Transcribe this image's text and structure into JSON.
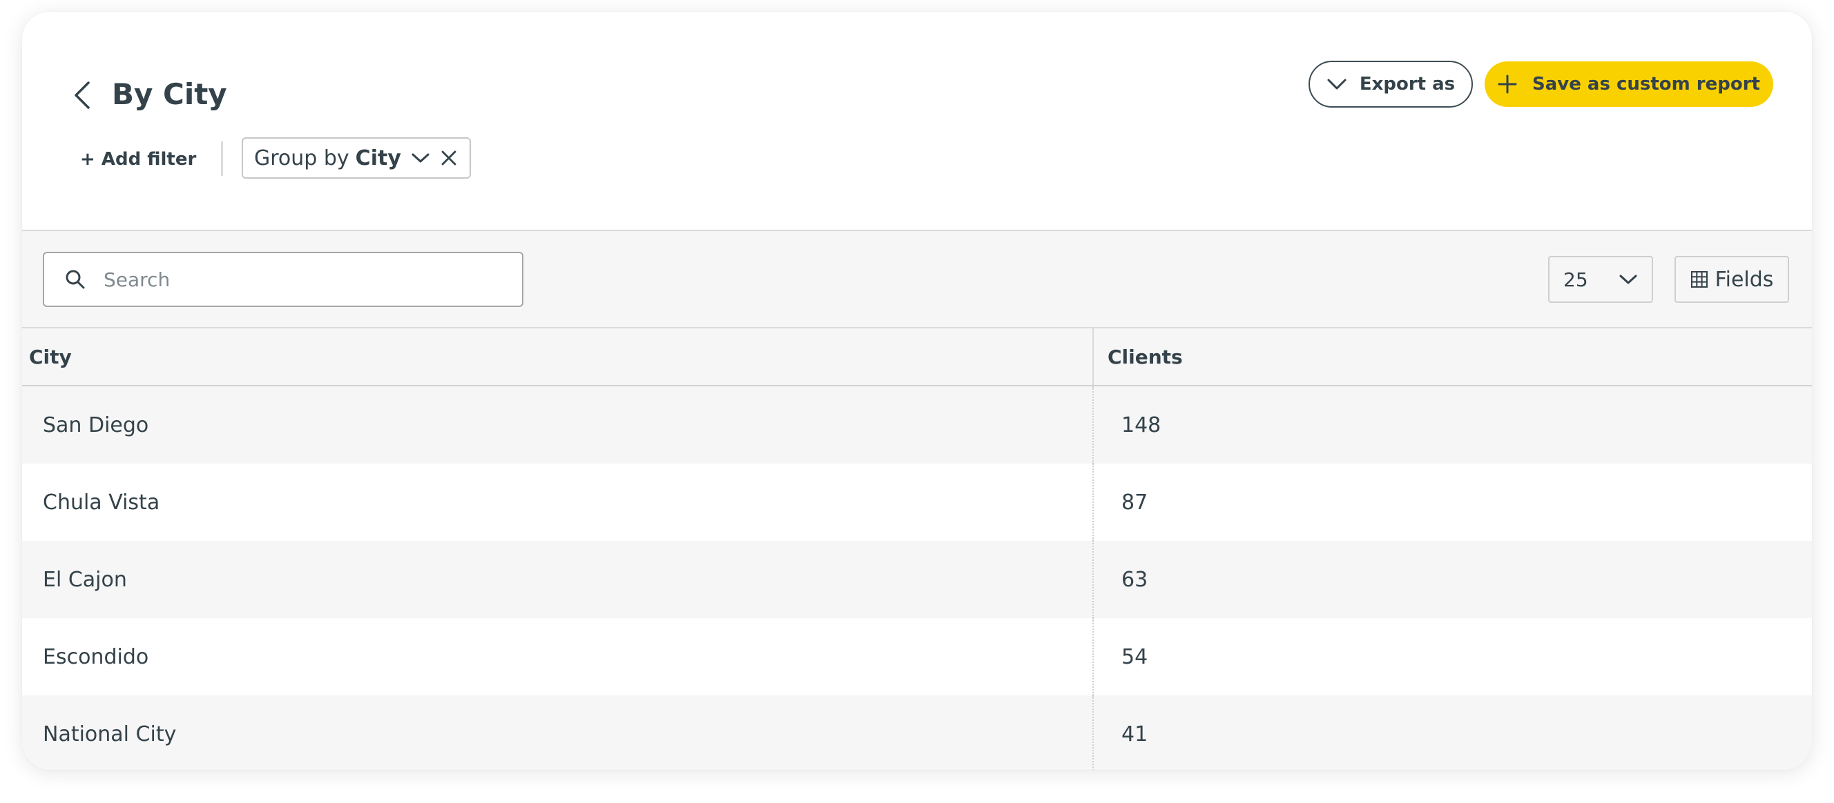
{
  "header": {
    "title": "By City",
    "export_label": "Export as",
    "save_label": "Save as custom report"
  },
  "filters": {
    "add_filter_label": "+ Add filter",
    "group_prefix": "Group by",
    "group_value": "City"
  },
  "toolbar": {
    "search_placeholder": "Search",
    "search_value": "",
    "page_size": "25",
    "fields_label": "Fields"
  },
  "table": {
    "columns": [
      "City",
      "Clients"
    ],
    "rows": [
      [
        "San Diego",
        "148"
      ],
      [
        "Chula Vista",
        "87"
      ],
      [
        "El Cajon",
        "63"
      ],
      [
        "Escondido",
        "54"
      ],
      [
        "National City",
        "41"
      ]
    ]
  },
  "colors": {
    "accent": "#f9d100",
    "text": "#34424a",
    "stripe": "#f6f6f6"
  },
  "icons": {
    "back": "chevron-left-icon",
    "export": "chevron-down-icon",
    "save": "plus-icon",
    "search": "search-icon",
    "fields": "grid-icon",
    "close": "close-icon"
  }
}
